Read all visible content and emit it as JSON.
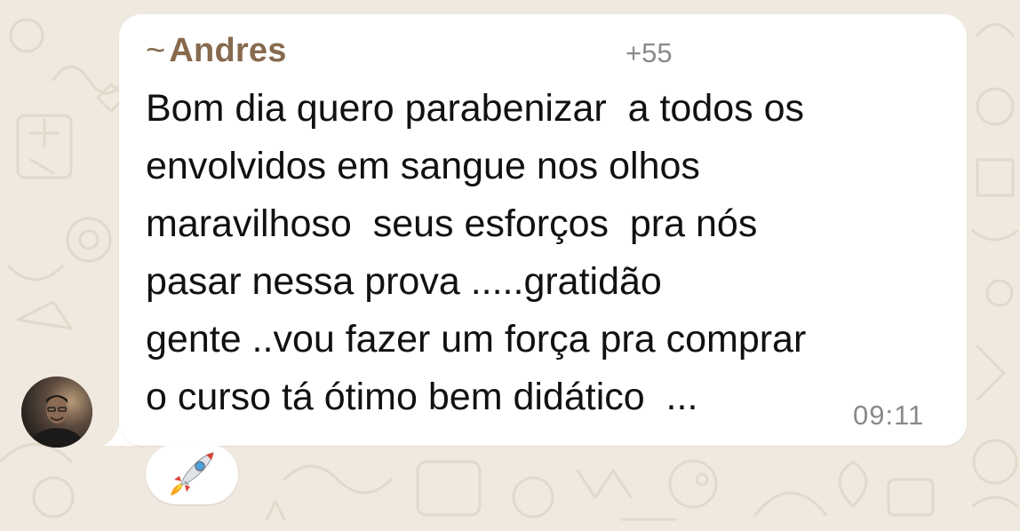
{
  "chat": {
    "message": {
      "sender": "Andres",
      "sender_prefix": "~",
      "sender_tag": "+55",
      "lines": [
        "Bom dia quero parabenizar  a todos os",
        "envolvidos em sangue nos olhos",
        "maravilhoso  seus esforços  pra nós",
        "pasar nessa prova .....gratidão",
        "gente ..vou fazer um força pra comprar",
        "o curso tá ótimo bem didático  ..."
      ],
      "time": "09:11"
    },
    "reaction": {
      "icon": "rocket-icon"
    },
    "avatar": {
      "icon": "avatar-photo"
    }
  },
  "colors": {
    "wallpaper": "#efe9df",
    "bubble": "#ffffff",
    "sender_name": "#876a4e",
    "meta_text": "#8a8a8a",
    "message_text": "#111111"
  }
}
